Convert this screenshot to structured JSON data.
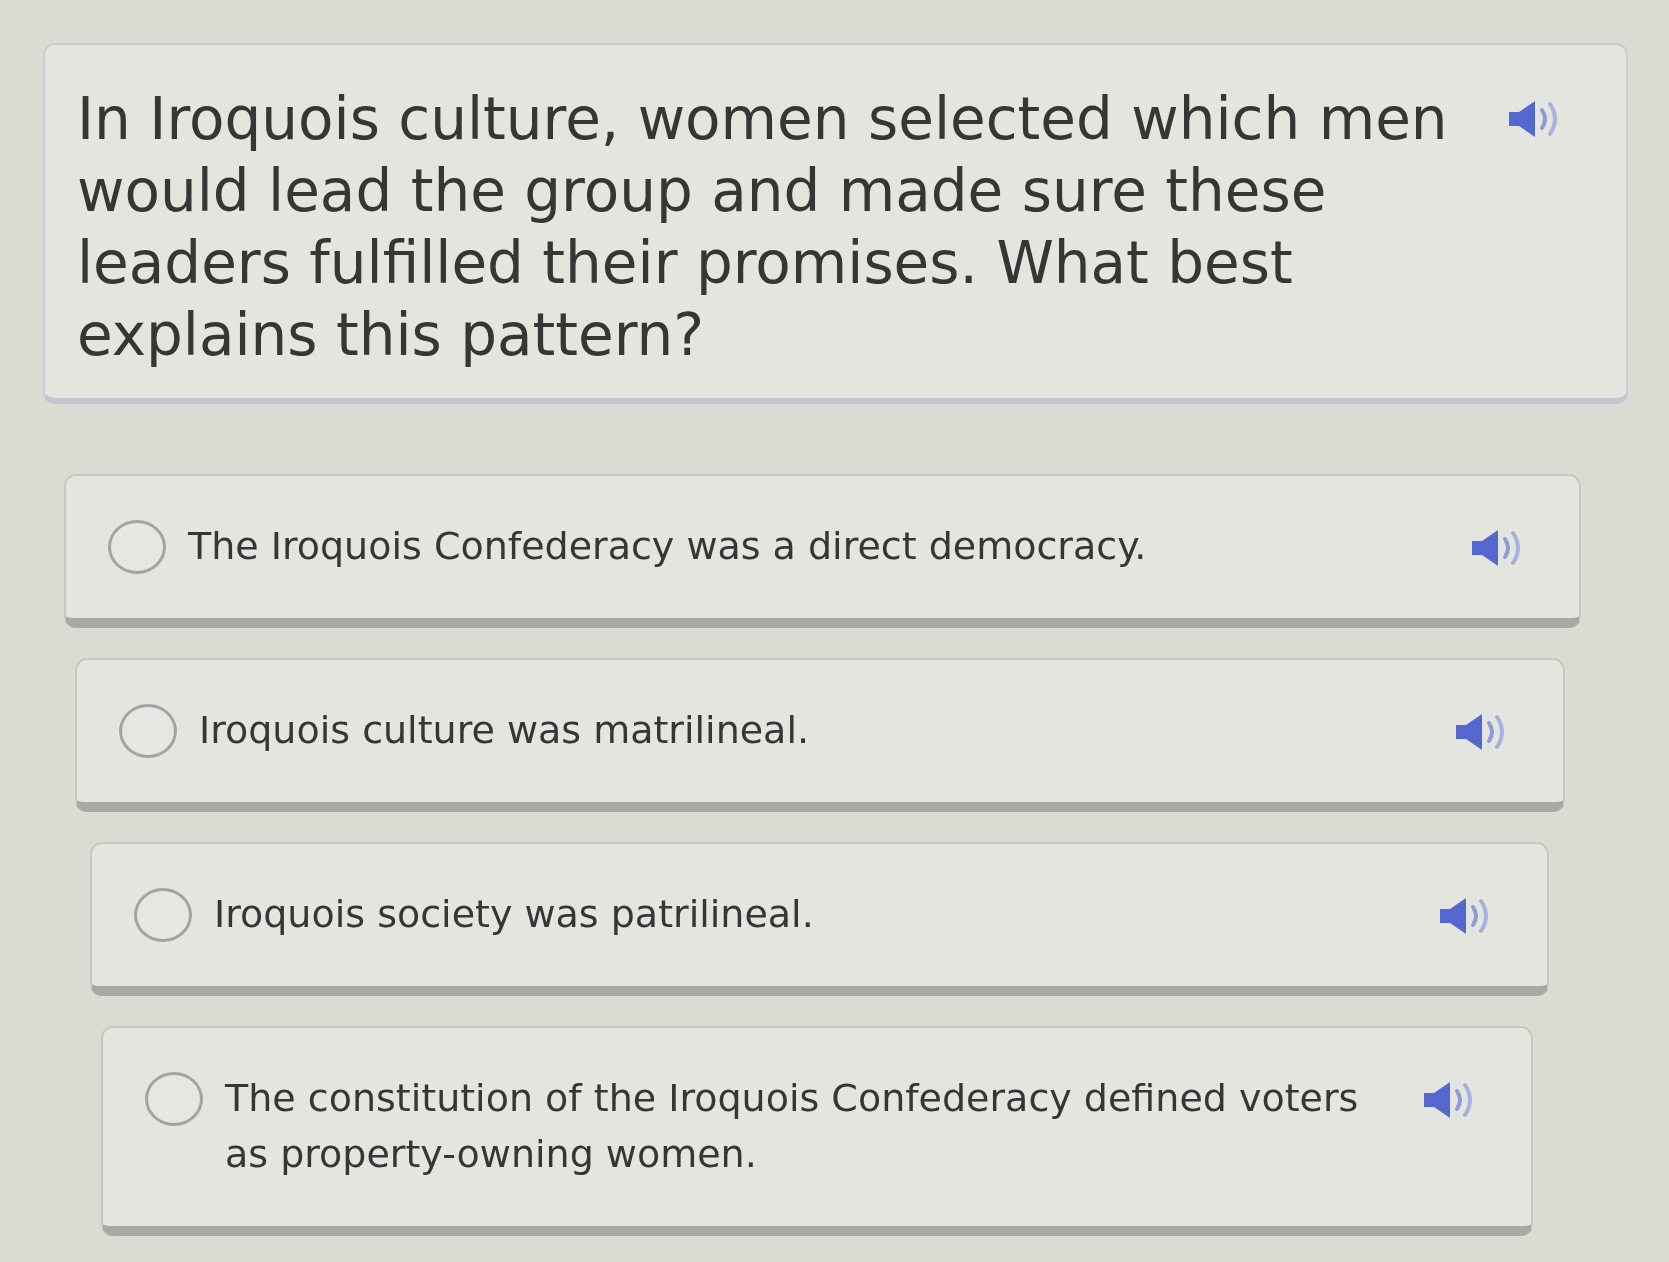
{
  "question": {
    "text": "In Iroquois culture, women selected which men would lead the group and made sure these leaders fulfilled their promises. What best explains this pattern?"
  },
  "options": [
    {
      "text": "The Iroquois Confederacy was a direct democracy.",
      "selected": false
    },
    {
      "text": "Iroquois culture was matrilineal.",
      "selected": false
    },
    {
      "text": "Iroquois society was patrilineal.",
      "selected": false
    },
    {
      "text": "The constitution of the Iroquois Confederacy defined voters as property-owning women.",
      "selected": false
    }
  ]
}
